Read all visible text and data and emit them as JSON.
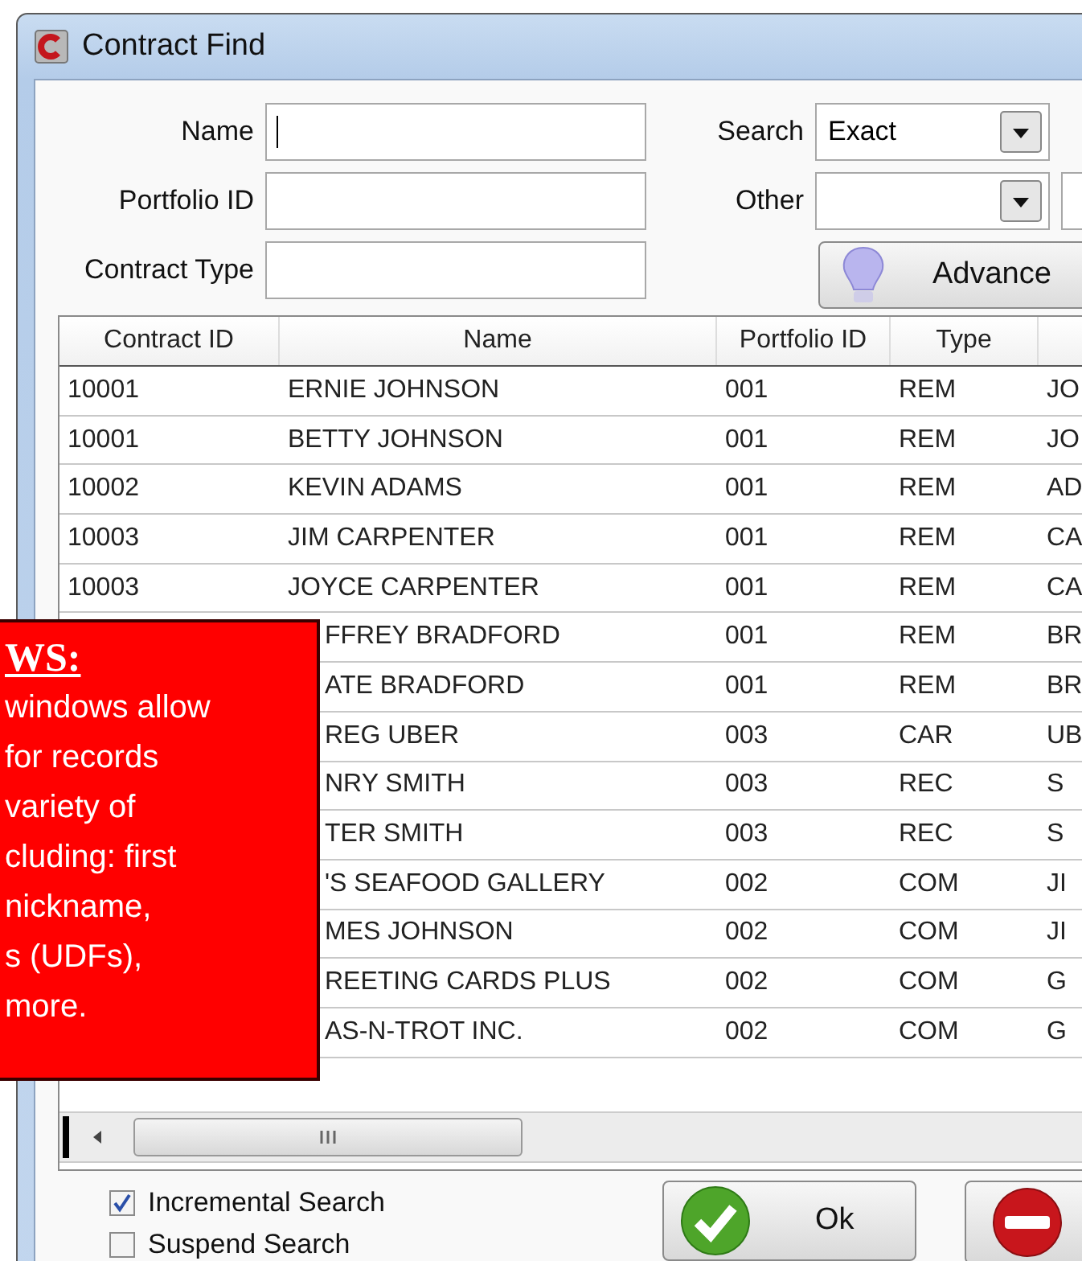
{
  "window": {
    "title": "Contract Find"
  },
  "form": {
    "fields": [
      {
        "label": "Name",
        "focused": true
      },
      {
        "label": "Portfolio ID",
        "focused": false
      },
      {
        "label": "Contract Type",
        "focused": false
      }
    ],
    "search": {
      "label": "Search",
      "value": "Exact"
    },
    "other": {
      "label": "Other"
    },
    "advanced_button": "Advance"
  },
  "table": {
    "columns": [
      "Contract ID",
      "Name",
      "Portfolio ID",
      "Type"
    ],
    "rows": [
      {
        "contract_id": "10001",
        "name": "ERNIE JOHNSON",
        "portfolio_id": "001",
        "type": "REM",
        "column_5": "JO"
      },
      {
        "contract_id": "10001",
        "name": "BETTY JOHNSON",
        "portfolio_id": "001",
        "type": "REM",
        "column_5": "JO"
      },
      {
        "contract_id": "10002",
        "name": "KEVIN ADAMS",
        "portfolio_id": "001",
        "type": "REM",
        "column_5": "AD"
      },
      {
        "contract_id": "10003",
        "name": "JIM CARPENTER",
        "portfolio_id": "001",
        "type": "REM",
        "column_5": "CA"
      },
      {
        "contract_id": "10003",
        "name": "JOYCE CARPENTER",
        "portfolio_id": "001",
        "type": "REM",
        "column_5": "CA"
      },
      {
        "name": "FFREY BRADFORD",
        "portfolio_id": "001",
        "type": "REM",
        "column_5": "BR"
      },
      {
        "name": "ATE BRADFORD",
        "portfolio_id": "001",
        "type": "REM",
        "column_5": "BR"
      },
      {
        "name": "REG UBER",
        "portfolio_id": "003",
        "type": "CAR",
        "column_5": "UB"
      },
      {
        "name": "NRY SMITH",
        "portfolio_id": "003",
        "type": "REC",
        "column_5": "S"
      },
      {
        "name": "TER SMITH",
        "portfolio_id": "003",
        "type": "REC",
        "column_5": "S"
      },
      {
        "name": "'S SEAFOOD GALLERY",
        "portfolio_id": "002",
        "type": "COM",
        "column_5": "JI"
      },
      {
        "name": "MES JOHNSON",
        "portfolio_id": "002",
        "type": "COM",
        "column_5": "JI"
      },
      {
        "name": "REETING CARDS PLUS",
        "portfolio_id": "002",
        "type": "COM",
        "column_5": "G"
      },
      {
        "name": "AS-N-TROT INC.",
        "portfolio_id": "002",
        "type": "COM",
        "column_5": "G"
      }
    ]
  },
  "options": [
    {
      "label": "Incremental Search",
      "checked": true
    },
    {
      "label": "Suspend Search",
      "checked": false
    }
  ],
  "ok_button": "Ok",
  "callout": {
    "heading": "WS:",
    "lines": [
      "windows allow",
      "for records",
      "variety of",
      "cluding: first",
      "nickname,",
      "s (UDFs),",
      "more."
    ]
  }
}
